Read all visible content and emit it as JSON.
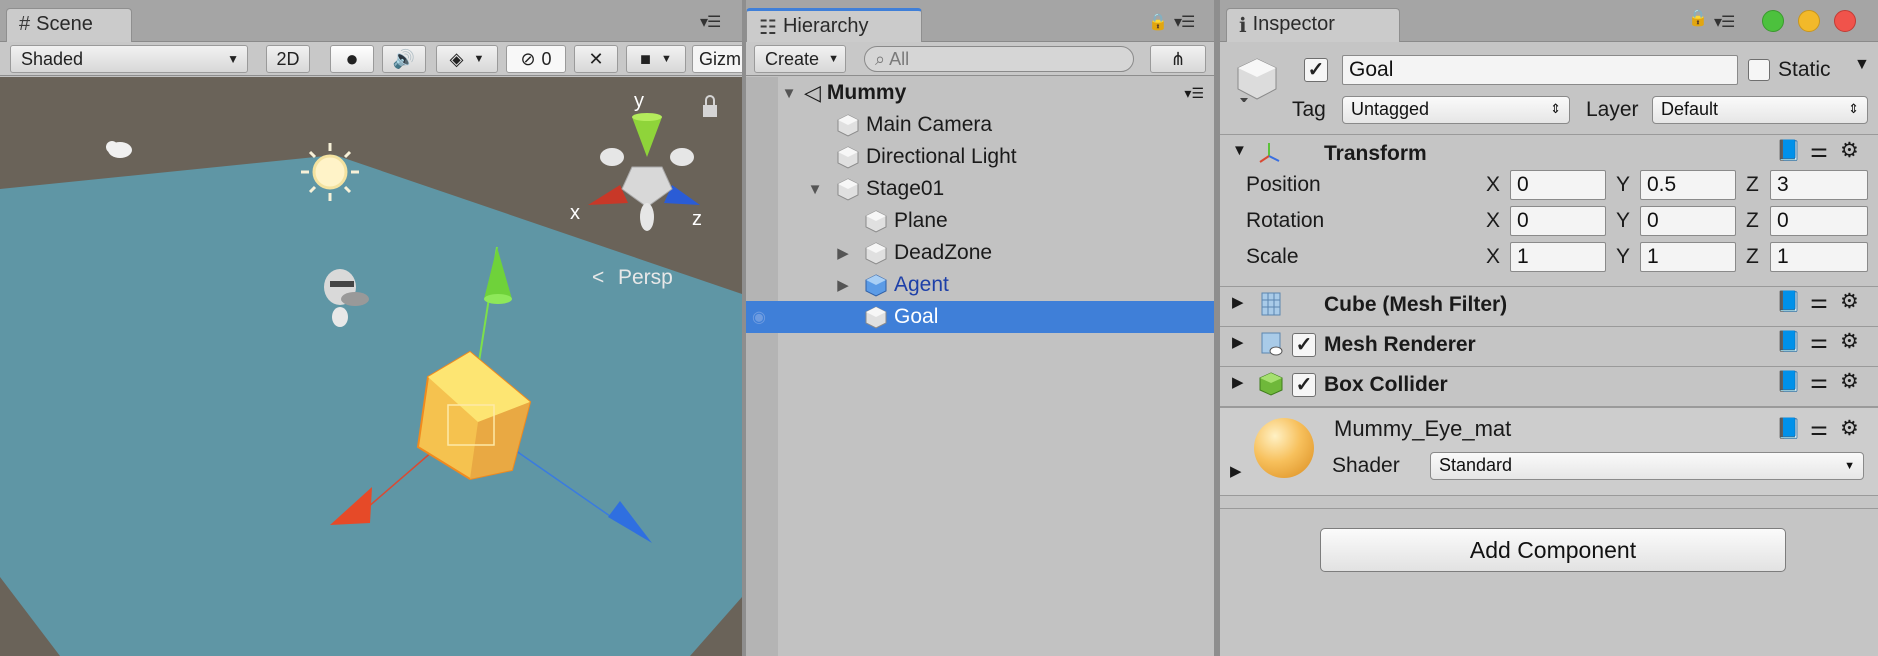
{
  "scene": {
    "tab_label": "Scene",
    "shading_mode": "Shaded",
    "toggle_2d": "2D",
    "hidden_count": "0",
    "gizmos_label": "Gizm",
    "persp_label": "Persp",
    "axis_x": "x",
    "axis_y": "y",
    "axis_z": "z"
  },
  "hierarchy": {
    "tab_label": "Hierarchy",
    "create_label": "Create",
    "search_placeholder": "All",
    "root": "Mummy",
    "items": [
      {
        "label": "Main Camera"
      },
      {
        "label": "Directional Light"
      },
      {
        "label": "Stage01"
      },
      {
        "label": "Plane"
      },
      {
        "label": "DeadZone"
      },
      {
        "label": "Agent"
      },
      {
        "label": "Goal"
      }
    ]
  },
  "inspector": {
    "tab_label": "Inspector",
    "object_name": "Goal",
    "static_label": "Static",
    "tag_label": "Tag",
    "tag_value": "Untagged",
    "layer_label": "Layer",
    "layer_value": "Default",
    "transform": {
      "title": "Transform",
      "position_label": "Position",
      "rotation_label": "Rotation",
      "scale_label": "Scale",
      "x": "X",
      "y": "Y",
      "z": "Z",
      "position": {
        "x": "0",
        "y": "0.5",
        "z": "3"
      },
      "rotation": {
        "x": "0",
        "y": "0",
        "z": "0"
      },
      "scale": {
        "x": "1",
        "y": "1",
        "z": "1"
      }
    },
    "components": [
      {
        "title": "Cube (Mesh Filter)"
      },
      {
        "title": "Mesh Renderer"
      },
      {
        "title": "Box Collider"
      }
    ],
    "material": {
      "name": "Mummy_Eye_mat",
      "shader_label": "Shader",
      "shader_value": "Standard"
    },
    "add_component_label": "Add Component"
  },
  "colors": {
    "selection": "#3f7fd8",
    "plane": "#5f96a5",
    "ground": "#6a6359",
    "goal_cube": "#f5b845",
    "agent_link": "#1d3fa8"
  }
}
